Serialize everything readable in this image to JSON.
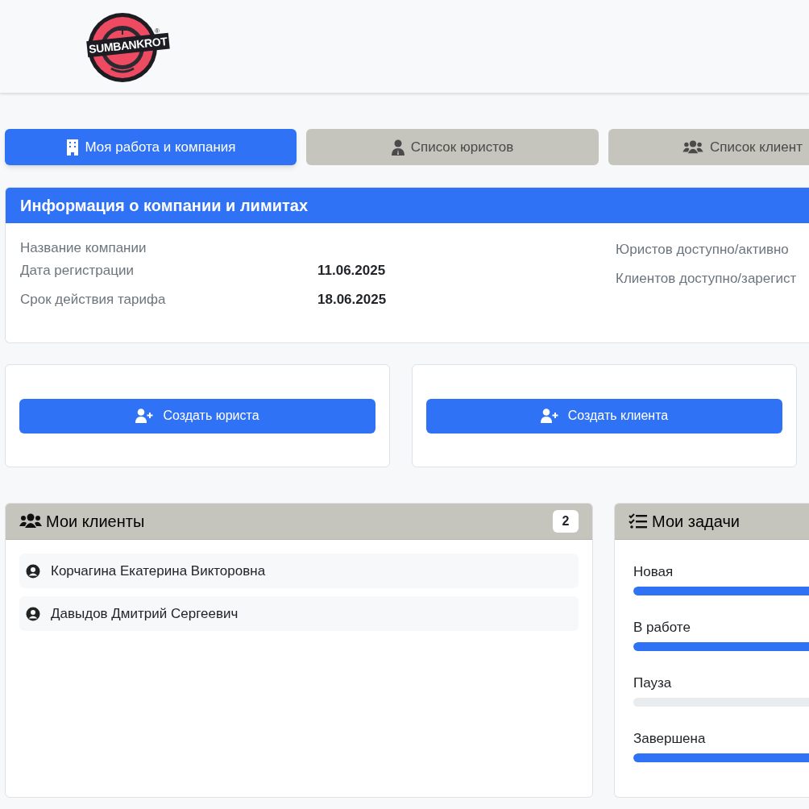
{
  "header": {
    "logo_text": "SUMBANKROT",
    "logo_mark": "®"
  },
  "tabs": [
    {
      "label": "Моя работа и компания",
      "kind": "building",
      "selected": true
    },
    {
      "label": "Список юристов",
      "kind": "user",
      "selected": false
    },
    {
      "label": "Список клиент",
      "kind": "users",
      "selected": false
    }
  ],
  "company_info": {
    "title": "Информация о компании и лимитах",
    "left": [
      {
        "label": "Название компании"
      },
      {
        "label": "Дата регистрации",
        "value": "11.06.2025"
      },
      {
        "label": "Срок действия тарифа",
        "value": "18.06.2025"
      }
    ],
    "right": [
      {
        "label": "Юристов доступно/активно"
      },
      {
        "label": "Клиентов доступно/зарегист"
      }
    ]
  },
  "actions": [
    {
      "label": "Создать юриста"
    },
    {
      "label": "Создать клиента"
    }
  ],
  "my_clients": {
    "title": "Мои клиенты",
    "count": "2",
    "items": [
      {
        "name": "Корчагина Екатерина Викторовна"
      },
      {
        "name": "Давыдов Дмитрий Сергеевич"
      }
    ]
  },
  "my_tasks": {
    "title": "Мои задачи",
    "items": [
      {
        "label": "Новая",
        "level": 1
      },
      {
        "label": "В работе",
        "level": 1
      },
      {
        "label": "Пауза",
        "level": 0
      },
      {
        "label": "Завершена",
        "level": 1
      }
    ]
  }
}
